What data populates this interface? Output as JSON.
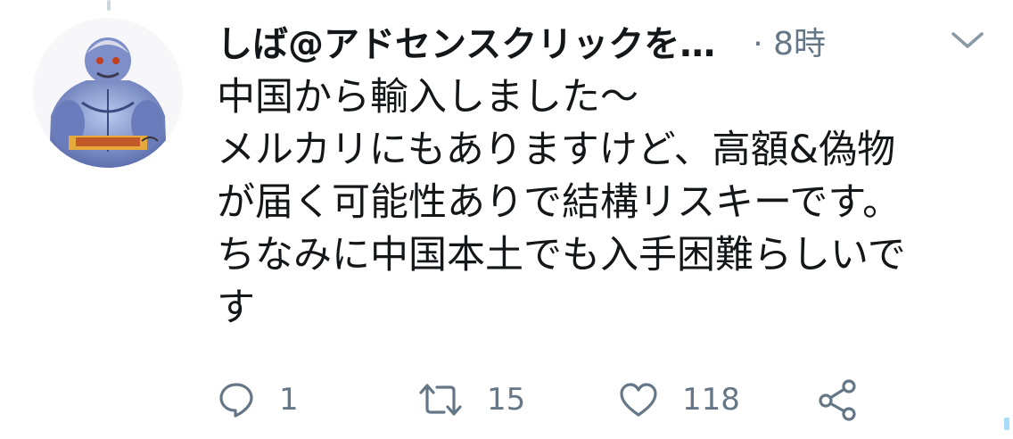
{
  "tweet": {
    "display_name": "しば@アドセンスクリックを…",
    "time": "· 8時",
    "avatar_icon": "muscleman-avatar-icon",
    "menu_icon": "chevron-down-icon",
    "text_lines": [
      "中国から輸入しました〜",
      "メルカリにもありますけど、高額&偽物",
      "が届く可能性ありで結構リスキーです。",
      "ちなみに中国本土でも入手困難らしいで",
      "す"
    ]
  },
  "actions": {
    "reply": {
      "icon": "reply-icon",
      "count": "1"
    },
    "retweet": {
      "icon": "retweet-icon",
      "count": "15"
    },
    "like": {
      "icon": "heart-icon",
      "count": "118"
    },
    "share": {
      "icon": "share-icon"
    }
  },
  "colors": {
    "text": "#14171a",
    "secondary": "#657786",
    "divider": "#ccd6dd"
  }
}
